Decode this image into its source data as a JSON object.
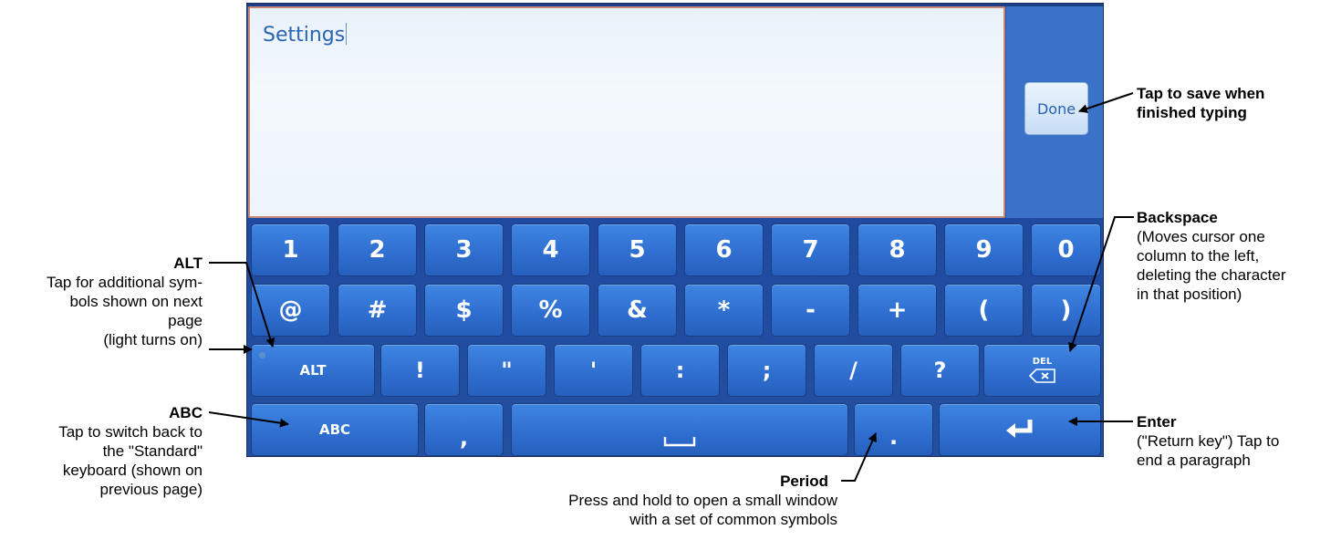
{
  "editor": {
    "text_value": "Settings",
    "done_label": "Done"
  },
  "keyboard": {
    "row1": [
      "1",
      "2",
      "3",
      "4",
      "5",
      "6",
      "7",
      "8",
      "9",
      "0"
    ],
    "row2": [
      "@",
      "#",
      "$",
      "%",
      "&",
      "*",
      "-",
      "+",
      "(",
      ")"
    ],
    "row3": [
      "ALT",
      "!",
      "\"",
      "'",
      ":",
      ";",
      "/",
      "?"
    ],
    "del_label": "DEL",
    "del_icon": "backspace-icon",
    "abc_label": "ABC",
    "comma_label": ",",
    "space_icon": "space-bar-icon",
    "period_label": ".",
    "enter_icon": "enter-arrow-icon"
  },
  "callouts": {
    "done": {
      "title": "Tap to save when",
      "desc": "finished typing"
    },
    "backspace": {
      "title": "Backspace",
      "desc": [
        "(Moves cursor one",
        "column to the left,",
        "deleting the character",
        "in that position)"
      ]
    },
    "alt": {
      "title": "ALT",
      "desc": [
        "Tap for additional sym-",
        "bols shown on next",
        "page",
        "(light turns on)"
      ]
    },
    "abc": {
      "title": "ABC",
      "desc": [
        "Tap to switch back to",
        "the \"Standard\"",
        "keyboard (shown on",
        "previous page)"
      ]
    },
    "period": {
      "title": "Period",
      "desc": [
        "Press and hold to open a small window",
        "with a set of common symbols"
      ]
    },
    "enter": {
      "title": "Enter",
      "desc": [
        "(\"Return key\") Tap to",
        "end a paragraph"
      ]
    }
  }
}
